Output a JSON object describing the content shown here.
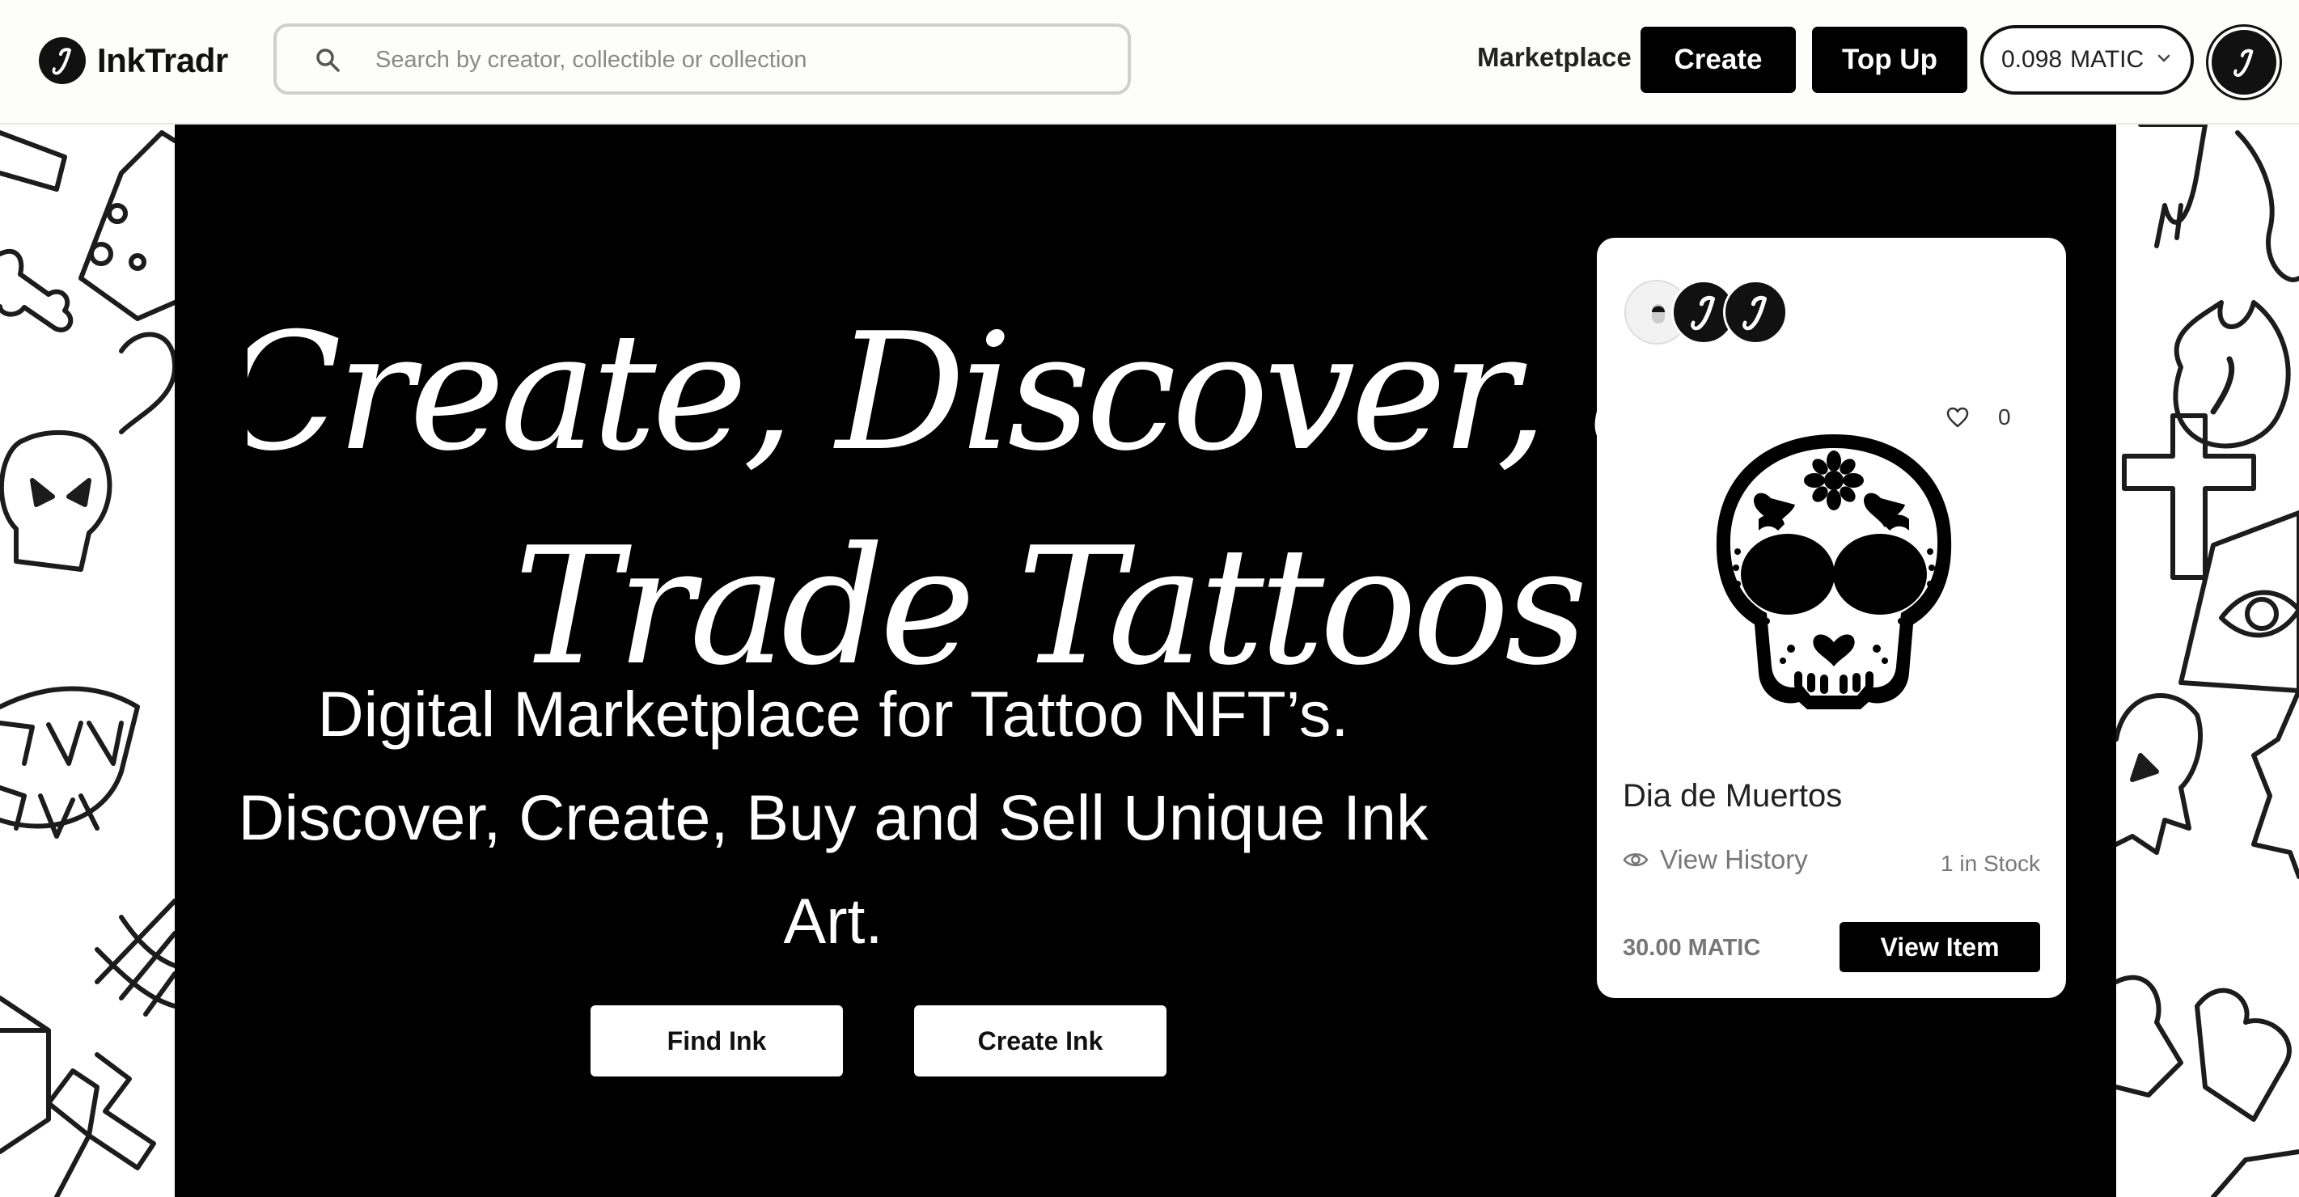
{
  "header": {
    "brand": "InkTradr",
    "search_placeholder": "Search by creator, collectible or collection",
    "nav_marketplace": "Marketplace",
    "create_label": "Create",
    "topup_label": "Top Up",
    "wallet_balance": "0.098",
    "wallet_currency": "MATIC"
  },
  "hero": {
    "headline_line1": "Create, Discover, and",
    "headline_line2": "Trade Tattoos",
    "tagline": "Digital Marketplace for Tattoo NFT’s. Discover, Create, Buy and Sell Unique Ink Art.",
    "find_button": "Find Ink",
    "create_button": "Create Ink"
  },
  "featured_card": {
    "likes": "0",
    "title": "Dia de Muertos",
    "history_label": "View History",
    "stock": "1 in Stock",
    "price": "30.00 MATIC",
    "view_button": "View Item"
  },
  "icons": {
    "brand_logo": "ink-logo-icon",
    "search": "search-icon",
    "wallet_dropdown": "chevron-down-icon",
    "like": "heart-icon",
    "history": "eye-icon"
  },
  "colors": {
    "primary": "#000000",
    "background": "#ffffff",
    "muted_text": "#777777"
  }
}
